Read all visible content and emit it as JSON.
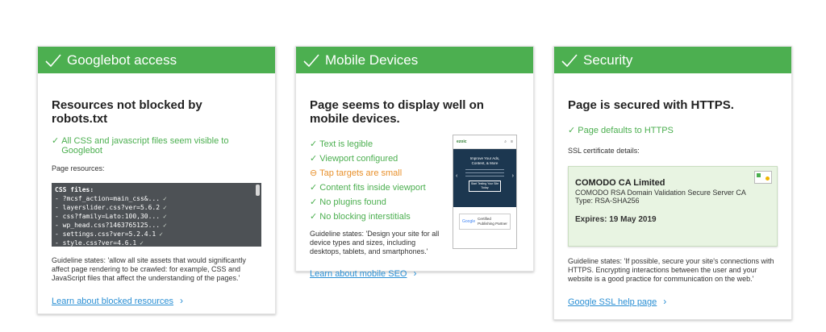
{
  "cards": [
    {
      "header": "Googlebot access",
      "title": "Resources not blocked by robots.txt",
      "status": "All CSS and javascript files seem visible to Googlebot",
      "resources_label": "Page resources:",
      "code_lines": [
        "CSS files:",
        "- ?mcsf_action=main_css&...",
        "- layerslider.css?ver=5.6.2",
        "- css?family=Lato:100,30...",
        "- wp_head.css?1463765125...",
        "- settings.css?ver=5.2.4.1",
        "- style.css?ver=4.6.1"
      ],
      "guideline": "Guideline states: 'allow all site assets that would significantly affect page rendering to be crawled: for example, CSS and JavaScript files that affect the understanding of the pages.'",
      "link": "Learn about blocked resources"
    },
    {
      "header": "Mobile Devices",
      "title": "Page seems to display well on mobile devices.",
      "checks": [
        {
          "text": "Text is legible",
          "state": "ok"
        },
        {
          "text": "Viewport configured",
          "state": "ok"
        },
        {
          "text": "Tap targets are small",
          "state": "warn"
        },
        {
          "text": "Content fits inside viewport",
          "state": "ok"
        },
        {
          "text": "No plugins found",
          "state": "ok"
        },
        {
          "text": "No blocking interstitials",
          "state": "ok"
        }
      ],
      "guideline": "Guideline states: 'Design your site for all device types and sizes, including desktops, tablets, and smartphones.'",
      "link": "Learn about mobile SEO",
      "preview": {
        "logo": "ezoic",
        "hero_line1": "Improve Your Ads,",
        "hero_line2": "Content, & More",
        "cta": "Start Testing Your Site Today",
        "badge_brand": "Google",
        "badge_text": "Certified Publishing Partner"
      }
    },
    {
      "header": "Security",
      "title": "Page is secured with HTTPS.",
      "status": "Page defaults to HTTPS",
      "ssl_label": "SSL certificate details:",
      "cert": {
        "name": "COMODO CA Limited",
        "issuer": "COMODO RSA Domain Validation Secure Server CA",
        "type": "Type: RSA-SHA256",
        "expires": "Expires: 19 May 2019"
      },
      "guideline": "Guideline states: 'If possible, secure your site's connections with HTTPS. Encrypting interactions between the user and your website is a good practice for communication on the web.'",
      "link": "Google SSL help page"
    }
  ],
  "colors": {
    "header_green": "#4caf50",
    "ok_green": "#4caf50",
    "warn_orange": "#e8902b",
    "link_blue": "#2a8fd4"
  }
}
